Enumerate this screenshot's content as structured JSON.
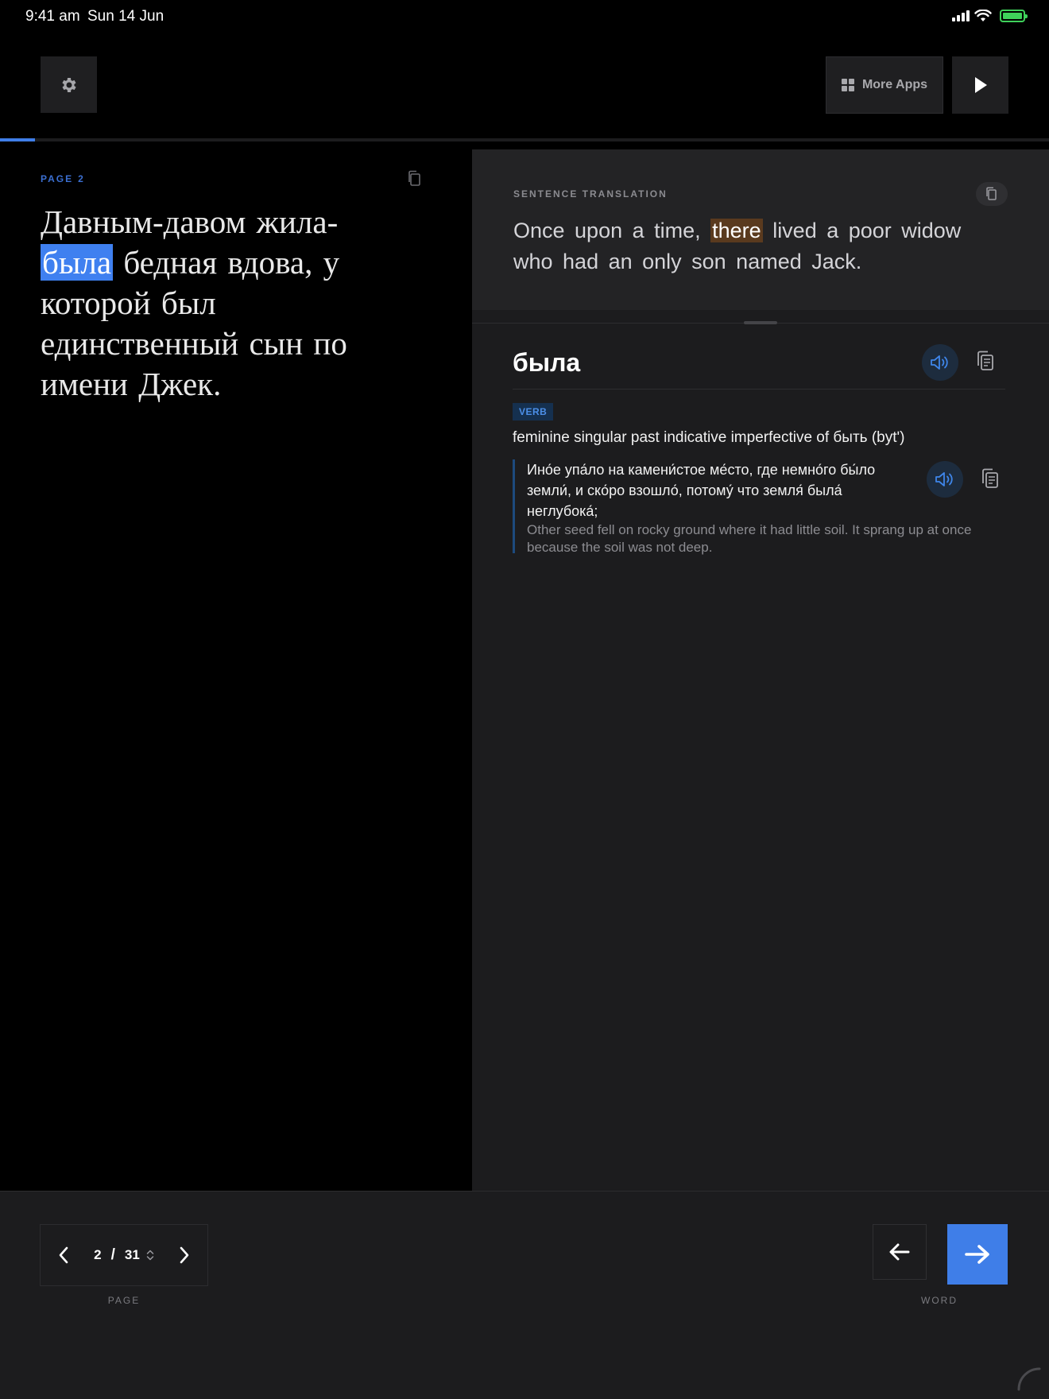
{
  "status_bar": {
    "time": "9:41 am",
    "date": "Sun 14 Jun"
  },
  "toolbar": {
    "more_apps_label": "More Apps"
  },
  "reading_progress": 0.033,
  "reader": {
    "page_label_word": "PAGE",
    "page_number": "2",
    "text_before": "Давным-давом жила-",
    "text_highlight": "была",
    "text_after": " бедная вдова, у которой был единственный сын по имени Джек."
  },
  "translation": {
    "label": "SENTENCE TRANSLATION",
    "text_before": "Once upon a time, ",
    "text_highlight": "there",
    "text_after": " lived a poor widow who had an only son named Jack."
  },
  "dictionary": {
    "headword": "была",
    "part_of_speech": "VERB",
    "definition": "feminine singular past indicative imperfective of быть (bytʹ)",
    "example_ru": "Ино́е упа́ло на камени́стое ме́сто, где немно́го бы́ло земли́, и ско́ро взошло́, потому́ что земля́ была́ неглубока́;",
    "example_en": "Other seed fell on rocky ground where it had little soil. It sprang up at once because the soil was not deep."
  },
  "pager": {
    "current": "2",
    "separator": "/",
    "total": "31",
    "label": "PAGE"
  },
  "word_nav": {
    "label": "WORD"
  },
  "colors": {
    "accent": "#3f7ee8",
    "highlight_source": "#3f80f0",
    "highlight_translation": "#5a3a1e",
    "battery": "#3fd15a"
  }
}
